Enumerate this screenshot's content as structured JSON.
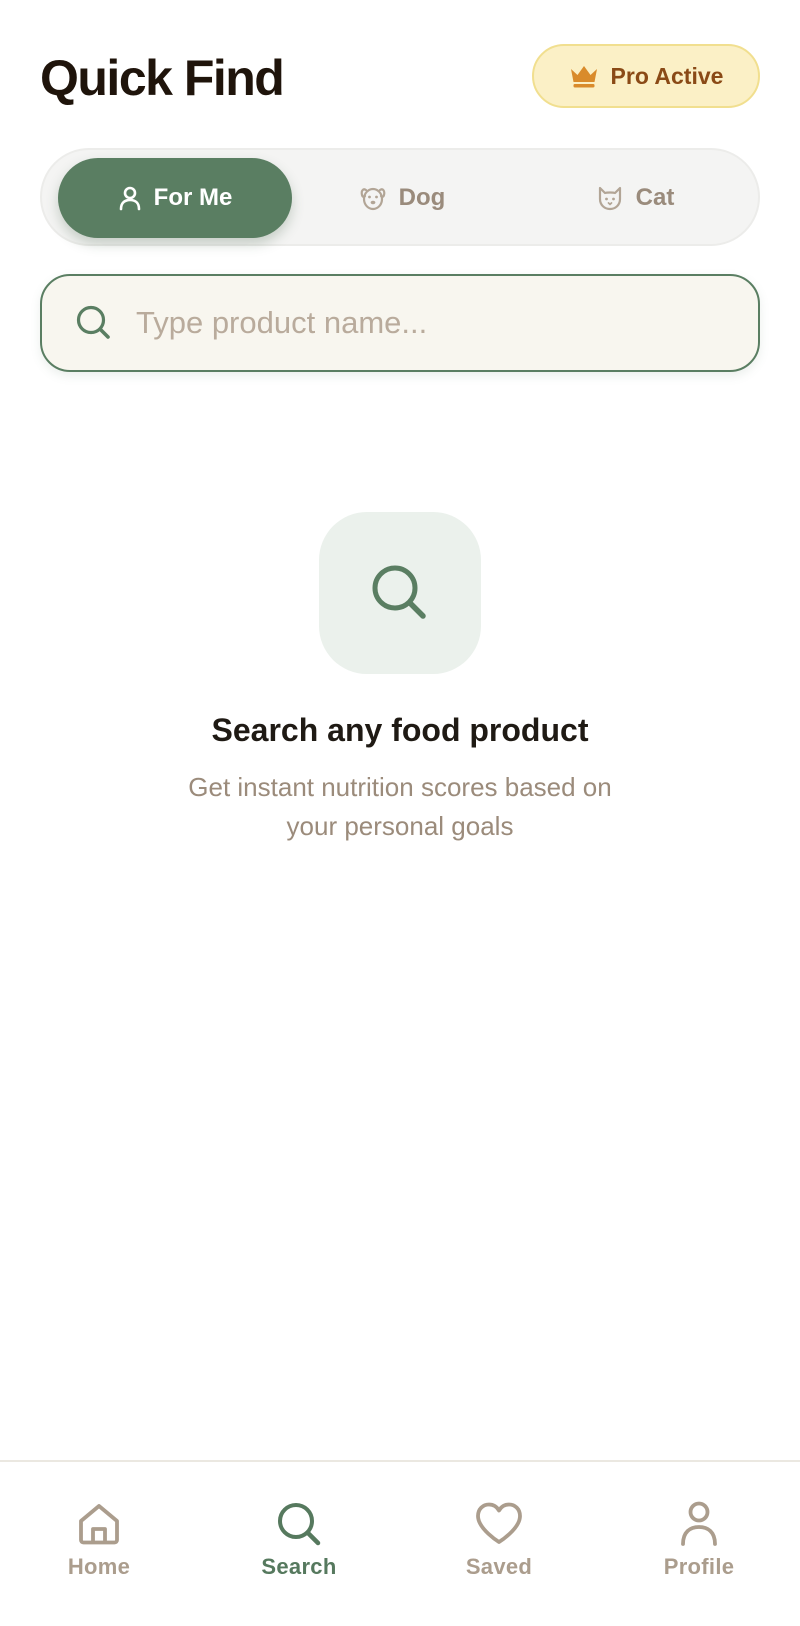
{
  "header": {
    "title": "Quick Find",
    "pro_badge": {
      "label": "Pro Active",
      "icon": "crown-icon"
    }
  },
  "profile_tabs": [
    {
      "label": "For Me",
      "icon": "person-icon",
      "active": true
    },
    {
      "label": "Dog",
      "icon": "dog-face-icon",
      "active": false
    },
    {
      "label": "Cat",
      "icon": "cat-face-icon",
      "active": false
    }
  ],
  "search": {
    "placeholder": "Type product name...",
    "value": "",
    "icon": "search-icon"
  },
  "empty_state": {
    "icon": "search-icon",
    "title": "Search any food product",
    "subtitle": "Get instant nutrition scores based on your personal goals"
  },
  "bottom_nav": [
    {
      "label": "Home",
      "icon": "home-icon",
      "active": false
    },
    {
      "label": "Search",
      "icon": "search-icon",
      "active": true
    },
    {
      "label": "Saved",
      "icon": "heart-icon",
      "active": false
    },
    {
      "label": "Profile",
      "icon": "person-icon",
      "active": false
    }
  ],
  "colors": {
    "accent_green": "#5a7e62",
    "pro_badge_bg": "#fbf0c6",
    "pro_badge_text": "#8a4a16",
    "crown": "#d98b2b",
    "muted_text": "#9b8b7b",
    "title_text": "#1f140b"
  }
}
